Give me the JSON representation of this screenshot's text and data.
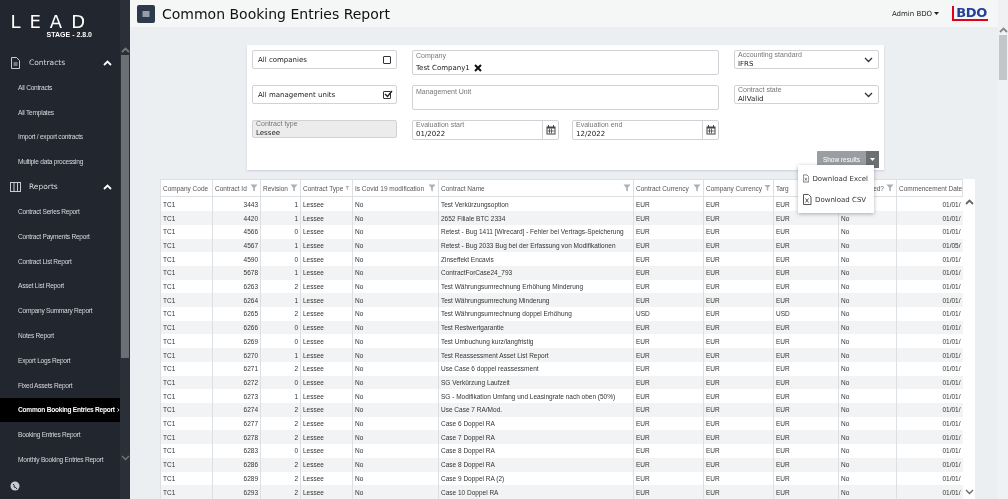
{
  "sidebar": {
    "logo": "LEAD",
    "version": "STAGE - 2.8.0",
    "sections": [
      {
        "label": "Contracts",
        "kind": "contracts",
        "expanded": true,
        "items": [
          {
            "label": "All Contracts",
            "selected": false
          },
          {
            "label": "All Templates",
            "selected": false
          },
          {
            "label": "Import / export contracts",
            "selected": false
          },
          {
            "label": "Multiple data processing",
            "selected": false
          }
        ]
      },
      {
        "label": "Reports",
        "kind": "reports",
        "expanded": true,
        "items": [
          {
            "label": "Contract Series Report",
            "selected": false
          },
          {
            "label": "Contract Payments Report",
            "selected": false
          },
          {
            "label": "Contract List Report",
            "selected": false
          },
          {
            "label": "Asset List Report",
            "selected": false
          },
          {
            "label": "Company Summary Report",
            "selected": false
          },
          {
            "label": "Notes Report",
            "selected": false
          },
          {
            "label": "Export Logs Report",
            "selected": false
          },
          {
            "label": "Fixed Assets Report",
            "selected": false
          },
          {
            "label": "Common Booking Entries Report",
            "selected": true
          },
          {
            "label": "Booking Entries Report",
            "selected": false
          },
          {
            "label": "Monthly Booking Entries Report",
            "selected": false
          }
        ]
      }
    ]
  },
  "header": {
    "title": "Common Booking Entries Report",
    "user": "Admin BDO",
    "brand": "BDO"
  },
  "filters": {
    "all_companies": {
      "label": "All companies",
      "checked": false
    },
    "company": {
      "label": "Company",
      "tags": [
        "Test Company1"
      ]
    },
    "accounting_standard": {
      "label": "Accounting standard",
      "value": "IFRS"
    },
    "all_management_units": {
      "label": "All management units",
      "checked": true
    },
    "management_unit": {
      "label": "Management Unit"
    },
    "contract_state": {
      "label": "Contract state",
      "value": "AllValid"
    },
    "contract_type": {
      "label": "Contract type",
      "value": "Lessee",
      "disabled": true
    },
    "evaluation_start": {
      "label": "Evaluation start",
      "value": "01/2022"
    },
    "evaluation_end": {
      "label": "Evaluation end",
      "value": "12/2022"
    },
    "show_results": {
      "label": "Show results",
      "disabled": true
    }
  },
  "export_menu": {
    "items": [
      {
        "label": "Download Excel"
      },
      {
        "label": "Download CSV"
      }
    ]
  },
  "table": {
    "columns": [
      "Company Code",
      "Contract Id",
      "Revision",
      "Contract Type",
      "Is Covid 19 modification",
      "Contract Name",
      "Contract Currency",
      "Company Currency",
      "Targ",
      "ed?",
      "Commencement Date"
    ],
    "rows": [
      {
        "cells": [
          "TC1",
          "3443",
          "1",
          "Lessee",
          "No",
          "Test Verkürzungsoption",
          "EUR",
          "EUR",
          "EUR",
          null,
          "01/01/"
        ]
      },
      {
        "cells": [
          "TC1",
          "4420",
          "1",
          "Lessee",
          "No",
          "2652 Filiale BTC 2334",
          "EUR",
          "EUR",
          "EUR",
          "No",
          "01/01/"
        ]
      },
      {
        "cells": [
          "TC1",
          "4566",
          "0",
          "Lessee",
          "No",
          "Retest - Bug 1411 [Wirecard] - Fehler bei Vertrags-Speicherung",
          "EUR",
          "EUR",
          "EUR",
          "No",
          "01/01/"
        ]
      },
      {
        "cells": [
          "TC1",
          "4567",
          "1",
          "Lessee",
          "No",
          "Retest - Bug 2033 Bug bei der Erfassung von Modifikationen",
          "EUR",
          "EUR",
          "EUR",
          "No",
          "01/05/"
        ]
      },
      {
        "cells": [
          "TC1",
          "4590",
          "0",
          "Lessee",
          "No",
          "Zinseffekt Encavis",
          "EUR",
          "EUR",
          "EUR",
          "No",
          "01/01/"
        ]
      },
      {
        "cells": [
          "TC1",
          "5678",
          "1",
          "Lessee",
          "No",
          "ContractForCase24_793",
          "EUR",
          "EUR",
          "EUR",
          "No",
          "01/01/"
        ]
      },
      {
        "cells": [
          "TC1",
          "6263",
          "2",
          "Lessee",
          "No",
          "Test Währungsumrechnung Erhöhung Minderung",
          "EUR",
          "EUR",
          "EUR",
          "No",
          "01/01/"
        ]
      },
      {
        "cells": [
          "TC1",
          "6264",
          "1",
          "Lessee",
          "No",
          "Test Währungsumrechung Minderung",
          "EUR",
          "EUR",
          "EUR",
          "No",
          "01/01/"
        ]
      },
      {
        "cells": [
          "TC1",
          "6265",
          "2",
          "Lessee",
          "No",
          "Test Währungsumrechnung doppel Erhöhung",
          "USD",
          "EUR",
          "USD",
          "No",
          "01/01/"
        ]
      },
      {
        "cells": [
          "TC1",
          "6266",
          "0",
          "Lessee",
          "No",
          "Test Restwertgarantie",
          "EUR",
          "EUR",
          "EUR",
          "No",
          "01/01/"
        ]
      },
      {
        "cells": [
          "TC1",
          "6269",
          "0",
          "Lessee",
          "No",
          "Test Umbuchung kurz/langfristig",
          "EUR",
          "EUR",
          "EUR",
          "No",
          "01/01/"
        ]
      },
      {
        "cells": [
          "TC1",
          "6270",
          "1",
          "Lessee",
          "No",
          "Test Reassessment Asset List Report",
          "EUR",
          "EUR",
          "EUR",
          "No",
          "01/01/"
        ]
      },
      {
        "cells": [
          "TC1",
          "6271",
          "2",
          "Lessee",
          "No",
          "Use Case 6 doppel reassessment",
          "EUR",
          "EUR",
          "EUR",
          "No",
          "01/01/"
        ]
      },
      {
        "cells": [
          "TC1",
          "6272",
          "0",
          "Lessee",
          "No",
          "SG Verkürzung Laufzeit",
          "EUR",
          "EUR",
          "EUR",
          "No",
          "01/01/"
        ]
      },
      {
        "cells": [
          "TC1",
          "6273",
          "1",
          "Lessee",
          "No",
          "SG - Modifikation Umfang und Leasingrate nach oben (50%)",
          "EUR",
          "EUR",
          "EUR",
          "No",
          "01/01/"
        ]
      },
      {
        "cells": [
          "TC1",
          "6274",
          "2",
          "Lessee",
          "No",
          "Use Case 7 RA/Mod.",
          "EUR",
          "EUR",
          "EUR",
          "No",
          "01/01/"
        ]
      },
      {
        "cells": [
          "TC1",
          "6277",
          "2",
          "Lessee",
          "No",
          "Case 6 Doppel RA",
          "EUR",
          "EUR",
          "EUR",
          "No",
          "01/01/"
        ]
      },
      {
        "cells": [
          "TC1",
          "6278",
          "2",
          "Lessee",
          "No",
          "Case 7 Doppel RA",
          "EUR",
          "EUR",
          "EUR",
          "No",
          "01/01/"
        ]
      },
      {
        "cells": [
          "TC1",
          "6283",
          "0",
          "Lessee",
          "No",
          "Case 8 Doppel RA",
          "EUR",
          "EUR",
          "EUR",
          "No",
          "01/01/"
        ]
      },
      {
        "cells": [
          "TC1",
          "6286",
          "2",
          "Lessee",
          "No",
          "Case 8 Doppel RA",
          "EUR",
          "EUR",
          "EUR",
          "No",
          "01/01/"
        ]
      },
      {
        "cells": [
          "TC1",
          "6289",
          "2",
          "Lessee",
          "No",
          "Case 9 Doppel RA (2)",
          "EUR",
          "EUR",
          "EUR",
          "No",
          "01/01/"
        ]
      },
      {
        "cells": [
          "TC1",
          "6293",
          "2",
          "Lessee",
          "No",
          "Case 10 Doppel RA",
          "EUR",
          "EUR",
          "EUR",
          "No",
          "01/01/"
        ]
      }
    ]
  }
}
